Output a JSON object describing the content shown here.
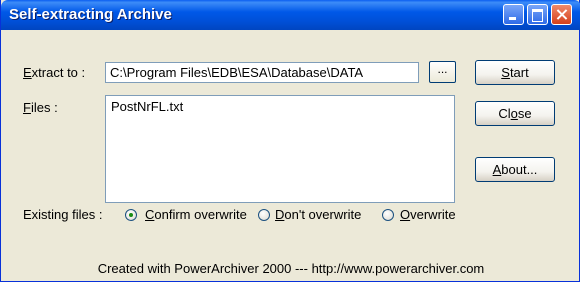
{
  "window": {
    "title": "Self-extracting Archive"
  },
  "extract": {
    "label_accel": "E",
    "label_rest": "xtract to :",
    "path": "C:\\Program Files\\EDB\\ESA\\Database\\DATA",
    "browse_label": "..."
  },
  "files": {
    "label_accel": "F",
    "label_rest": "iles :",
    "items": [
      "PostNrFL.txt"
    ]
  },
  "buttons": {
    "start": {
      "accel": "S",
      "rest": "tart"
    },
    "close": {
      "pre": "Cl",
      "accel": "o",
      "rest": "se"
    },
    "about": {
      "accel": "A",
      "rest": "bout..."
    }
  },
  "existing": {
    "label": "Existing files :",
    "options": [
      {
        "accel": "C",
        "rest": "onfirm overwrite",
        "checked": true
      },
      {
        "accel": "D",
        "rest": "on't overwrite",
        "checked": false
      },
      {
        "accel": "O",
        "rest": "verwrite",
        "checked": false
      }
    ]
  },
  "footer": {
    "text": "Created with PowerArchiver 2000 --- http://www.powerarchiver.com"
  }
}
